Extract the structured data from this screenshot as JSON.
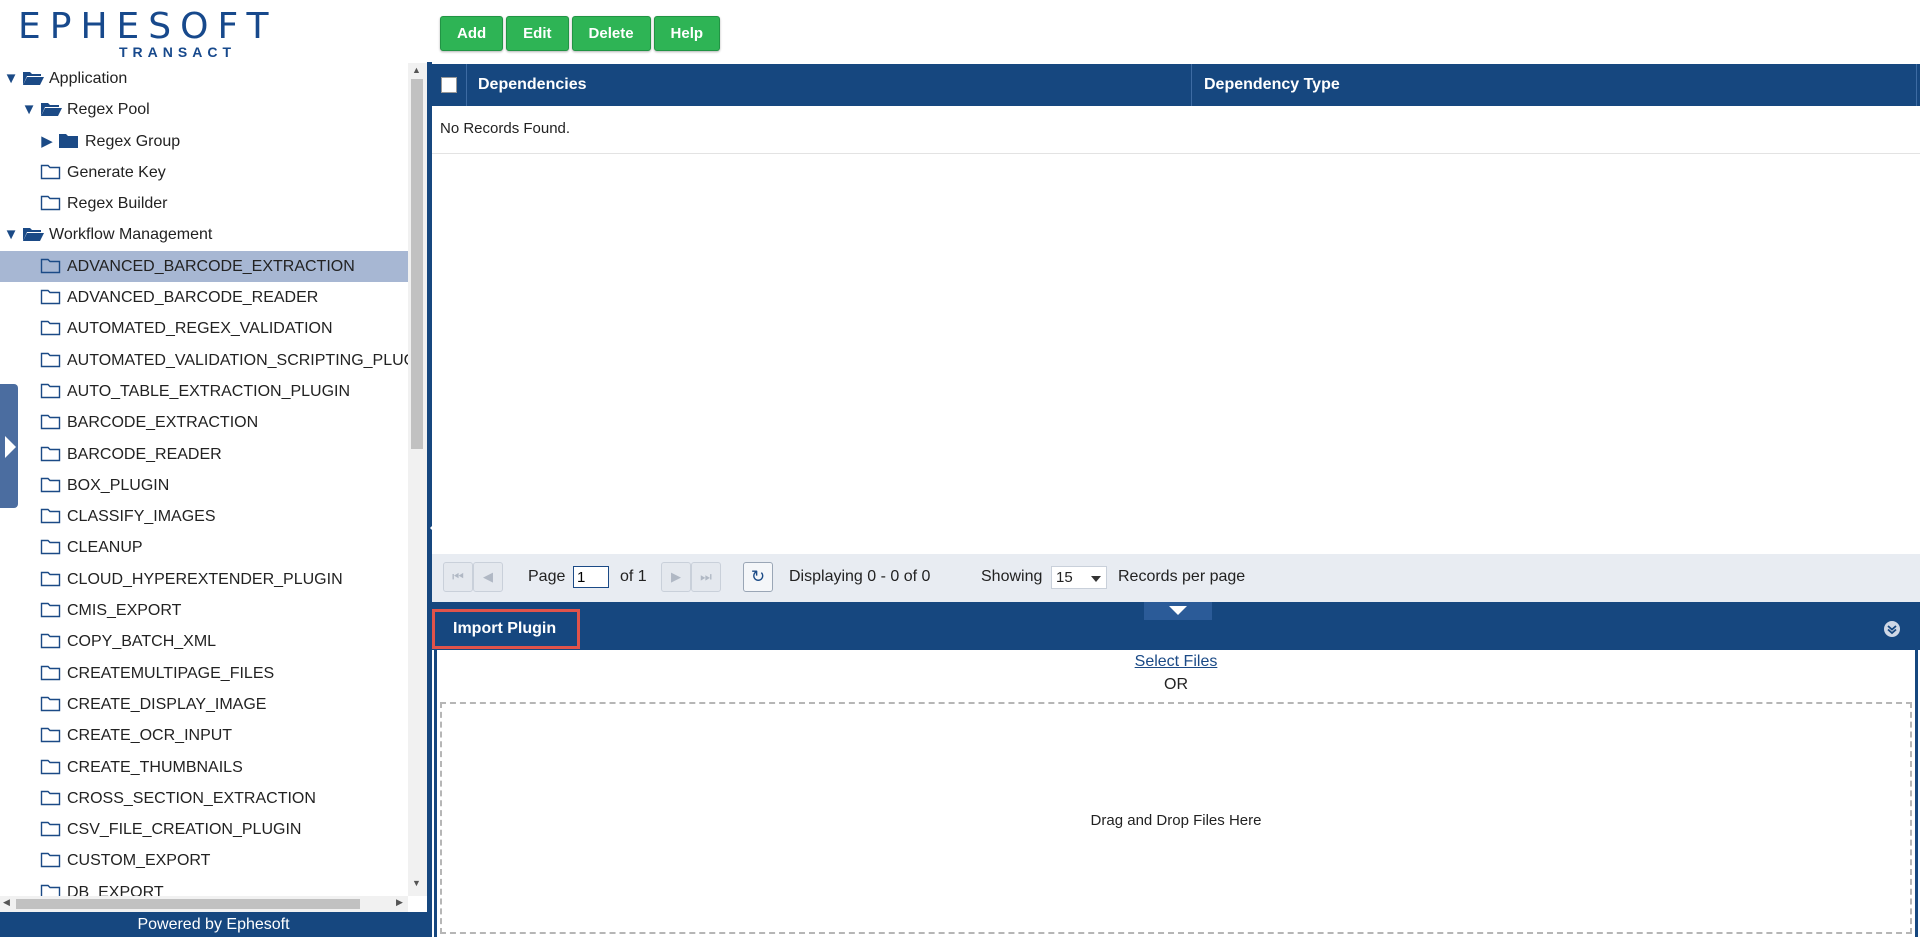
{
  "logo": {
    "brand": "EPHESOFT",
    "sub": "TRANSACT"
  },
  "tree": [
    {
      "label": "Application",
      "level": 0,
      "toggle": "down",
      "folder": "open"
    },
    {
      "label": "Regex Pool",
      "level": 1,
      "toggle": "down",
      "folder": "open"
    },
    {
      "label": "Regex Group",
      "level": 2,
      "toggle": "right",
      "folder": "closed-filled"
    },
    {
      "label": "Generate Key",
      "level": 1,
      "toggle": "none",
      "folder": "outline"
    },
    {
      "label": "Regex Builder",
      "level": 1,
      "toggle": "none",
      "folder": "outline"
    },
    {
      "label": "Workflow Management",
      "level": 0,
      "toggle": "down",
      "folder": "open"
    },
    {
      "label": "ADVANCED_BARCODE_EXTRACTION",
      "level": 1,
      "toggle": "none",
      "folder": "outline",
      "selected": true
    },
    {
      "label": "ADVANCED_BARCODE_READER",
      "level": 1,
      "toggle": "none",
      "folder": "outline"
    },
    {
      "label": "AUTOMATED_REGEX_VALIDATION",
      "level": 1,
      "toggle": "none",
      "folder": "outline"
    },
    {
      "label": "AUTOMATED_VALIDATION_SCRIPTING_PLUGIN",
      "level": 1,
      "toggle": "none",
      "folder": "outline"
    },
    {
      "label": "AUTO_TABLE_EXTRACTION_PLUGIN",
      "level": 1,
      "toggle": "none",
      "folder": "outline"
    },
    {
      "label": "BARCODE_EXTRACTION",
      "level": 1,
      "toggle": "none",
      "folder": "outline"
    },
    {
      "label": "BARCODE_READER",
      "level": 1,
      "toggle": "none",
      "folder": "outline"
    },
    {
      "label": "BOX_PLUGIN",
      "level": 1,
      "toggle": "none",
      "folder": "outline"
    },
    {
      "label": "CLASSIFY_IMAGES",
      "level": 1,
      "toggle": "none",
      "folder": "outline"
    },
    {
      "label": "CLEANUP",
      "level": 1,
      "toggle": "none",
      "folder": "outline"
    },
    {
      "label": "CLOUD_HYPEREXTENDER_PLUGIN",
      "level": 1,
      "toggle": "none",
      "folder": "outline"
    },
    {
      "label": "CMIS_EXPORT",
      "level": 1,
      "toggle": "none",
      "folder": "outline"
    },
    {
      "label": "COPY_BATCH_XML",
      "level": 1,
      "toggle": "none",
      "folder": "outline"
    },
    {
      "label": "CREATEMULTIPAGE_FILES",
      "level": 1,
      "toggle": "none",
      "folder": "outline"
    },
    {
      "label": "CREATE_DISPLAY_IMAGE",
      "level": 1,
      "toggle": "none",
      "folder": "outline"
    },
    {
      "label": "CREATE_OCR_INPUT",
      "level": 1,
      "toggle": "none",
      "folder": "outline"
    },
    {
      "label": "CREATE_THUMBNAILS",
      "level": 1,
      "toggle": "none",
      "folder": "outline"
    },
    {
      "label": "CROSS_SECTION_EXTRACTION",
      "level": 1,
      "toggle": "none",
      "folder": "outline"
    },
    {
      "label": "CSV_FILE_CREATION_PLUGIN",
      "level": 1,
      "toggle": "none",
      "folder": "outline"
    },
    {
      "label": "CUSTOM_EXPORT",
      "level": 1,
      "toggle": "none",
      "folder": "outline"
    },
    {
      "label": "DB_EXPORT",
      "level": 1,
      "toggle": "none",
      "folder": "outline"
    }
  ],
  "footer": {
    "text": "Powered by Ephesoft"
  },
  "toolbar": {
    "add": "Add",
    "edit": "Edit",
    "delete": "Delete",
    "help": "Help"
  },
  "grid": {
    "columns": [
      "Dependencies",
      "Dependency Type"
    ],
    "empty_text": "No Records Found."
  },
  "pager": {
    "page_label": "Page",
    "page_value": "1",
    "of_label": "of 1",
    "displaying": "Displaying 0 - 0 of 0",
    "showing_label": "Showing",
    "per_page_value": "15",
    "records_label": "Records per page"
  },
  "import": {
    "title": "Import Plugin",
    "select_files": "Select Files",
    "or": "OR",
    "drop": "Drag and Drop Files Here"
  },
  "colors": {
    "navy": "#16477f",
    "green": "#2eb455",
    "selected_row": "#a7b7d3",
    "highlight_border": "#e0534a"
  },
  "icons": [
    "folder-open-icon",
    "folder-closed-icon",
    "folder-outline-icon",
    "triangle-down-icon",
    "triangle-right-icon",
    "first-page-icon",
    "prev-page-icon",
    "next-page-icon",
    "last-page-icon",
    "refresh-icon",
    "dropdown-caret-icon",
    "collapse-panel-icon"
  ]
}
